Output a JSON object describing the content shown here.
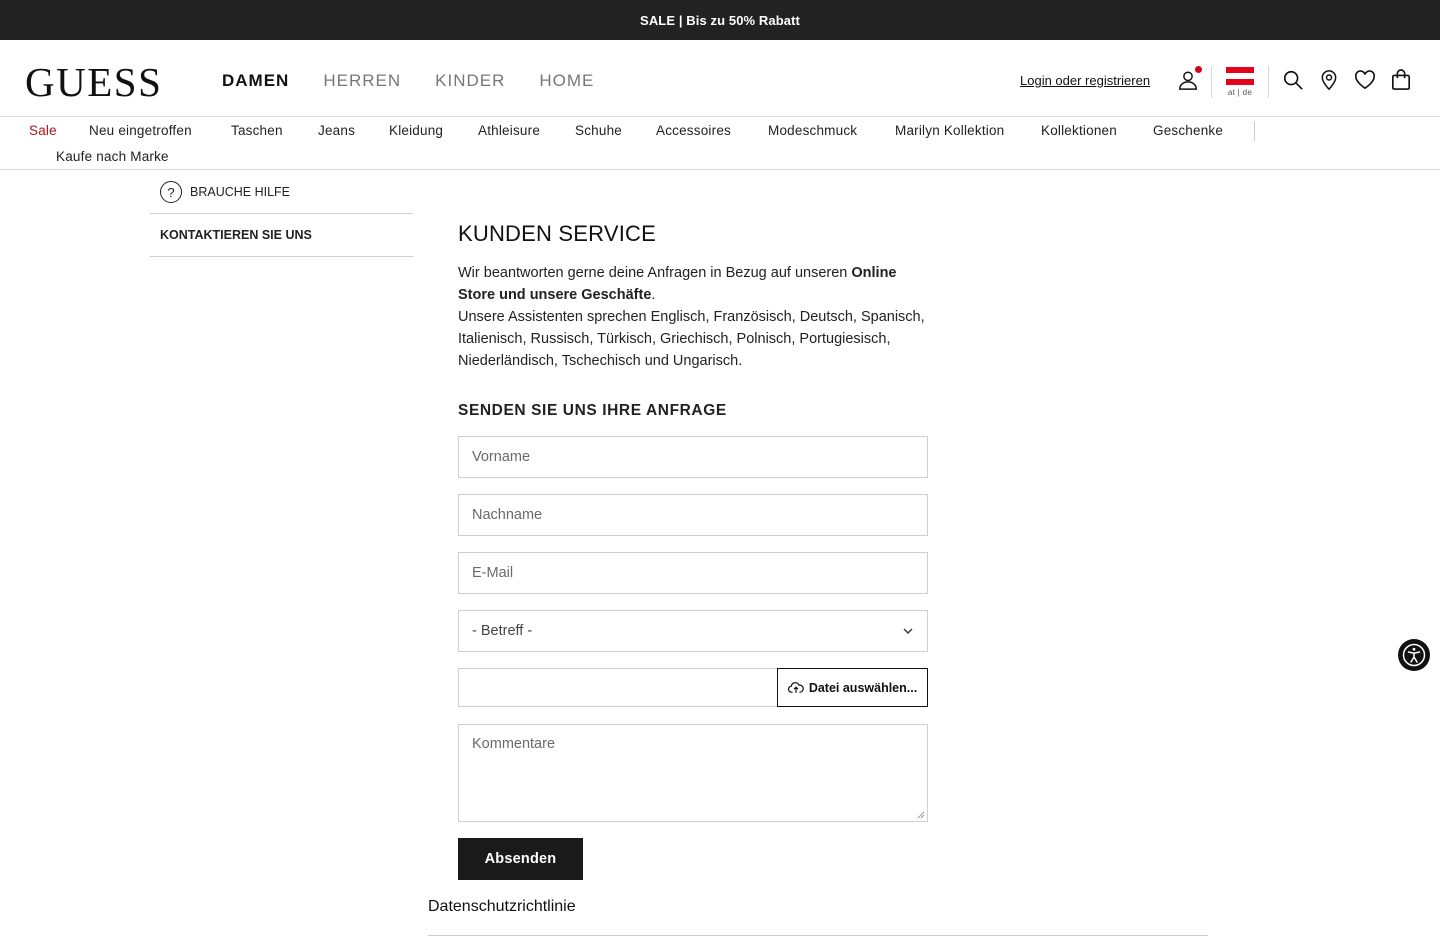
{
  "promo": {
    "text": "SALE | Bis zu 50% Rabatt"
  },
  "header": {
    "logo": "GUESS",
    "gender_nav": [
      {
        "label": "DAMEN",
        "active": true
      },
      {
        "label": "HERREN",
        "active": false
      },
      {
        "label": "KINDER",
        "active": false
      },
      {
        "label": "HOME",
        "active": false
      }
    ],
    "login_label": "Login oder registrieren",
    "country": {
      "code": "at | de",
      "flag_colors": [
        "#e4041c",
        "#ffffff",
        "#e4041c"
      ]
    },
    "icons": [
      "user-icon",
      "search-icon",
      "location-pin-icon",
      "heart-icon",
      "shopping-bag-icon"
    ]
  },
  "categories": [
    "Sale",
    "Neu eingetroffen",
    "Taschen",
    "Jeans",
    "Kleidung",
    "Athleisure",
    "Schuhe",
    "Accessoires",
    "Modeschmuck",
    "Marilyn Kollektion",
    "Kollektionen",
    "Geschenke",
    "Kaufe nach Marke"
  ],
  "sidebar": {
    "items": [
      {
        "label": "BRAUCHE HILFE",
        "icon": "question-circle-icon"
      },
      {
        "label": "KONTAKTIEREN SIE UNS"
      }
    ]
  },
  "main": {
    "title": "KUNDEN SERVICE",
    "intro_part1": "Wir beantworten gerne deine Anfragen in Bezug auf unseren ",
    "intro_bold": "Online Store und unsere Geschäfte",
    "intro_part2": ".",
    "intro_languages": "Unsere Assistenten sprechen Englisch, Französisch, Deutsch, Spanisch, Italienisch, Russisch, Türkisch, Griechisch, Polnisch, Portugiesisch, Niederländisch, Tschechisch und Ungarisch.",
    "form_title": "SENDEN SIE UNS IHRE ANFRAGE",
    "form": {
      "first_name_placeholder": "Vorname",
      "last_name_placeholder": "Nachname",
      "email_placeholder": "E-Mail",
      "subject_selected": "- Betreff -",
      "file_button": "Datei auswählen...",
      "comments_placeholder": "Kommentare",
      "submit_label": "Absenden"
    }
  },
  "privacy": {
    "label": "Datenschutzrichtlinie"
  },
  "colors": {
    "accent_sale": "#b5121b",
    "dark": "#1a1a1a",
    "notification": "#d3021b"
  }
}
